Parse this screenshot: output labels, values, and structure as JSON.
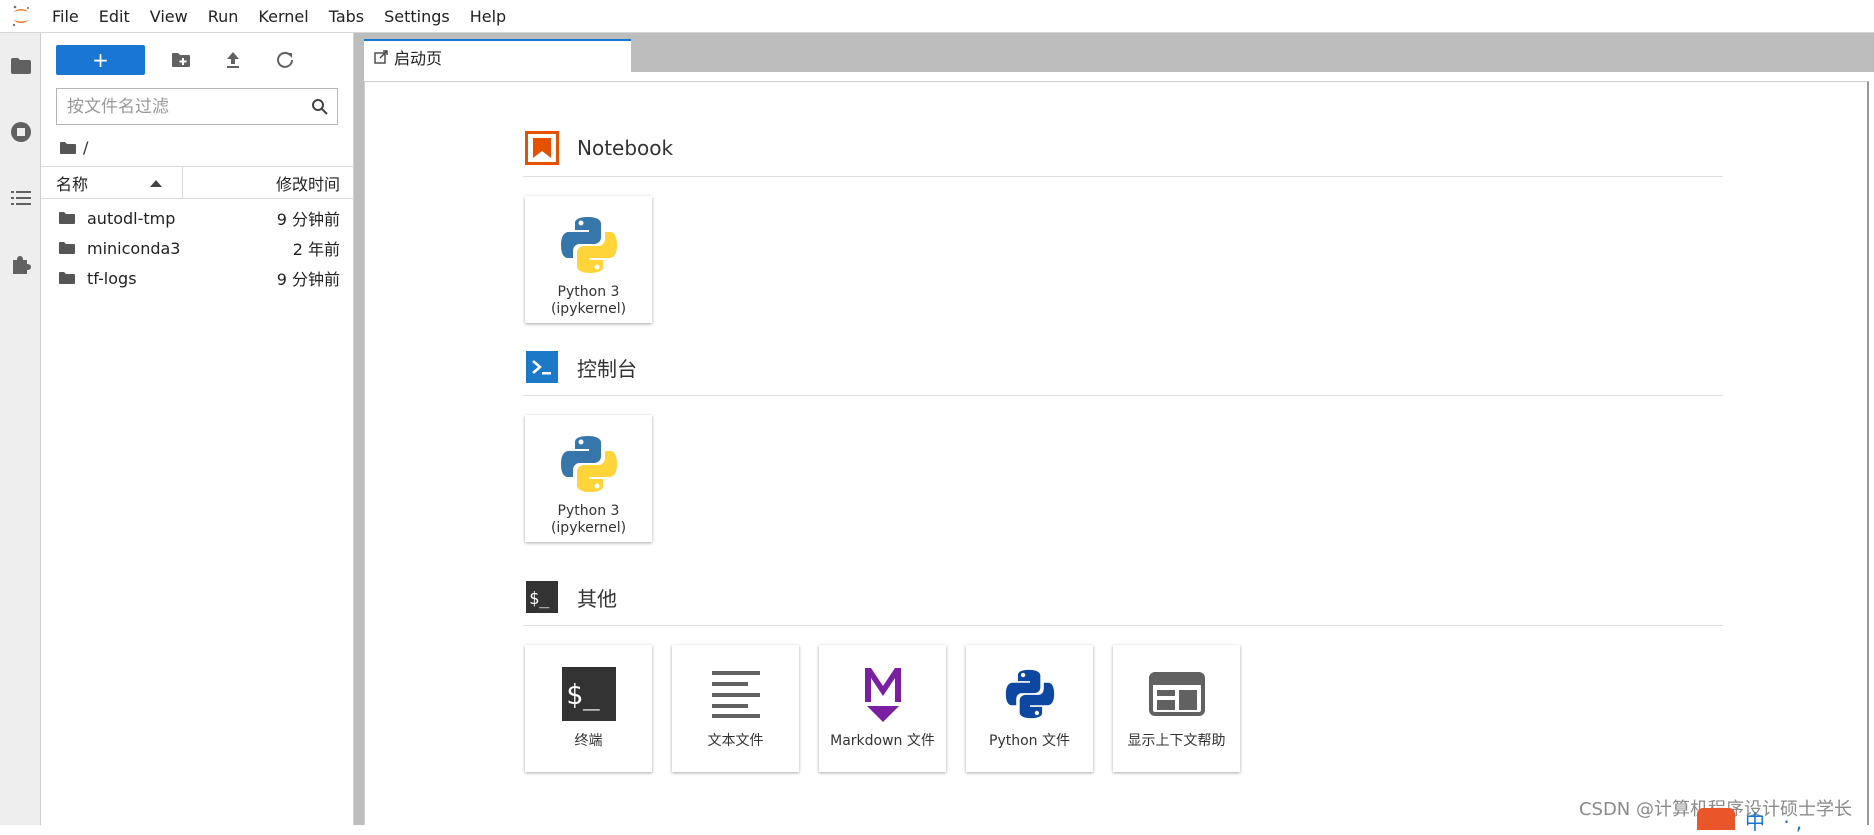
{
  "menubar": {
    "items": [
      "File",
      "Edit",
      "View",
      "Run",
      "Kernel",
      "Tabs",
      "Settings",
      "Help"
    ]
  },
  "sidebar": {
    "new_label": "+",
    "filter_placeholder": "按文件名过滤",
    "breadcrumb": "/",
    "headers": {
      "name": "名称",
      "modified": "修改时间"
    },
    "files": [
      {
        "name": "autodl-tmp",
        "modified": "9 分钟前"
      },
      {
        "name": "miniconda3",
        "modified": "2 年前"
      },
      {
        "name": "tf-logs",
        "modified": "9 分钟前"
      }
    ]
  },
  "tab": {
    "label": "启动页"
  },
  "launcher": {
    "sections": [
      {
        "title": "Notebook",
        "cards": [
          "Python 3 (ipykernel)"
        ]
      },
      {
        "title": "控制台",
        "cards": [
          "Python 3 (ipykernel)"
        ]
      },
      {
        "title": "其他",
        "cards": [
          "终端",
          "文本文件",
          "Markdown 文件",
          "Python 文件",
          "显示上下文帮助"
        ]
      }
    ]
  },
  "watermark": "CSDN @计算机程序设计硕士学长",
  "overlay_text": "中 ·,",
  "colors": {
    "accent": "#1976d2",
    "jupyter_orange": "#f37726",
    "notebook_orange": "#e65100",
    "markdown_purple": "#7b1fa2",
    "python_blue": "#0d47a1"
  }
}
